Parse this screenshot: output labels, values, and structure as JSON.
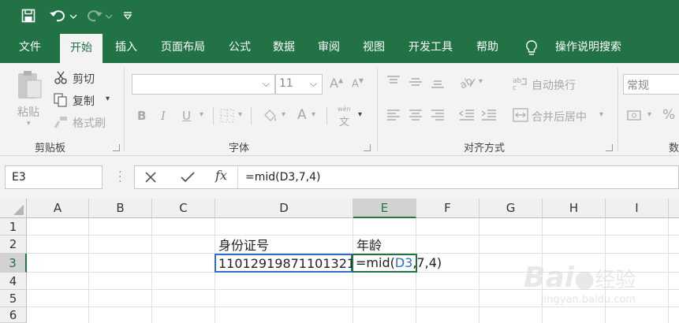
{
  "ribbon_tabs": {
    "file": "文件",
    "home": "开始",
    "insert": "插入",
    "layout": "页面布局",
    "formulas": "公式",
    "data": "数据",
    "review": "审阅",
    "view": "视图",
    "developer": "开发工具",
    "help": "帮助",
    "tell_me": "操作说明搜索"
  },
  "clipboard": {
    "paste": "粘贴",
    "cut": "剪切",
    "copy": "复制",
    "format_painter": "格式刷",
    "group_label": "剪贴板"
  },
  "font": {
    "size": "11",
    "bold": "B",
    "italic": "I",
    "underline": "U",
    "wen": "wén",
    "group_label": "字体"
  },
  "alignment": {
    "wrap_text": "自动换行",
    "merge_center": "合并后居中",
    "group_label": "对齐方式"
  },
  "number": {
    "format": "常规",
    "percent": "%",
    "group_label_partial": "数"
  },
  "formula_bar": {
    "name_box": "E3",
    "fx": "fx",
    "formula": "=mid(D3,7,4)"
  },
  "columns": [
    "A",
    "B",
    "C",
    "D",
    "E",
    "F",
    "G",
    "H",
    "I"
  ],
  "rows": [
    "1",
    "2",
    "3",
    "4",
    "5",
    "6"
  ],
  "cells": {
    "D2": "身份证号",
    "E2": "年龄",
    "D3": "11012919871101321",
    "E3_prefix": "=mid(",
    "E3_ref": "D3",
    "E3_suffix": ",7,4)"
  },
  "colors": {
    "accent": "#217346",
    "ref_blue": "#2f6fc4"
  },
  "watermark": {
    "brand": "Bai",
    "brand2": "经验",
    "url": "jingyan.baidu.com"
  }
}
